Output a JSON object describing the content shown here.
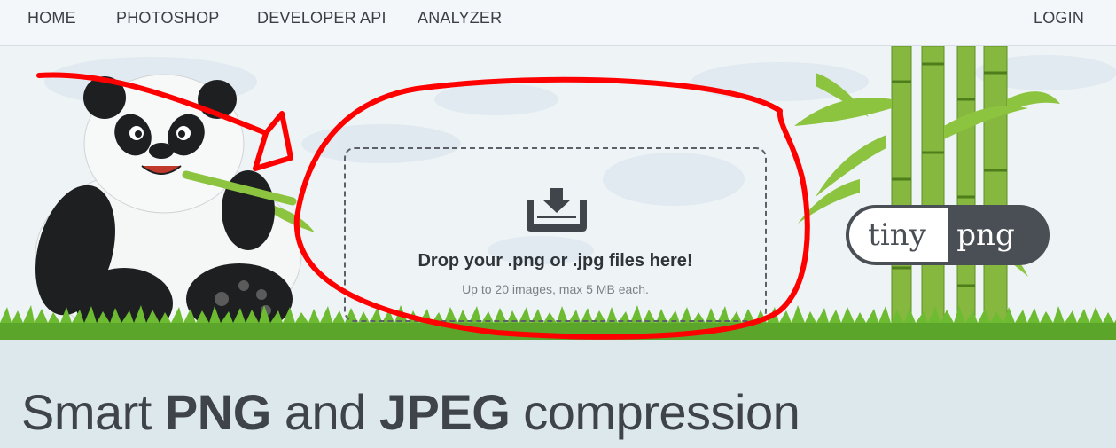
{
  "nav": {
    "items": [
      "HOME",
      "PHOTOSHOP",
      "DEVELOPER API",
      "ANALYZER"
    ],
    "login": "LOGIN"
  },
  "dropzone": {
    "icon": "download-tray-icon",
    "title": "Drop your .png or .jpg files here!",
    "subtitle": "Up to 20 images, max 5 MB each."
  },
  "logo": {
    "left_text": "tiny",
    "right_text": "png"
  },
  "headline": {
    "part1": "Smart ",
    "bold1": "PNG",
    "part2": " and ",
    "bold2": "JPEG",
    "part3": " compression"
  },
  "colors": {
    "annotation_red": "#ff0000",
    "bamboo_green": "#7fb43a",
    "grass_green": "#5aa52a",
    "text_dark": "#3e444a"
  }
}
